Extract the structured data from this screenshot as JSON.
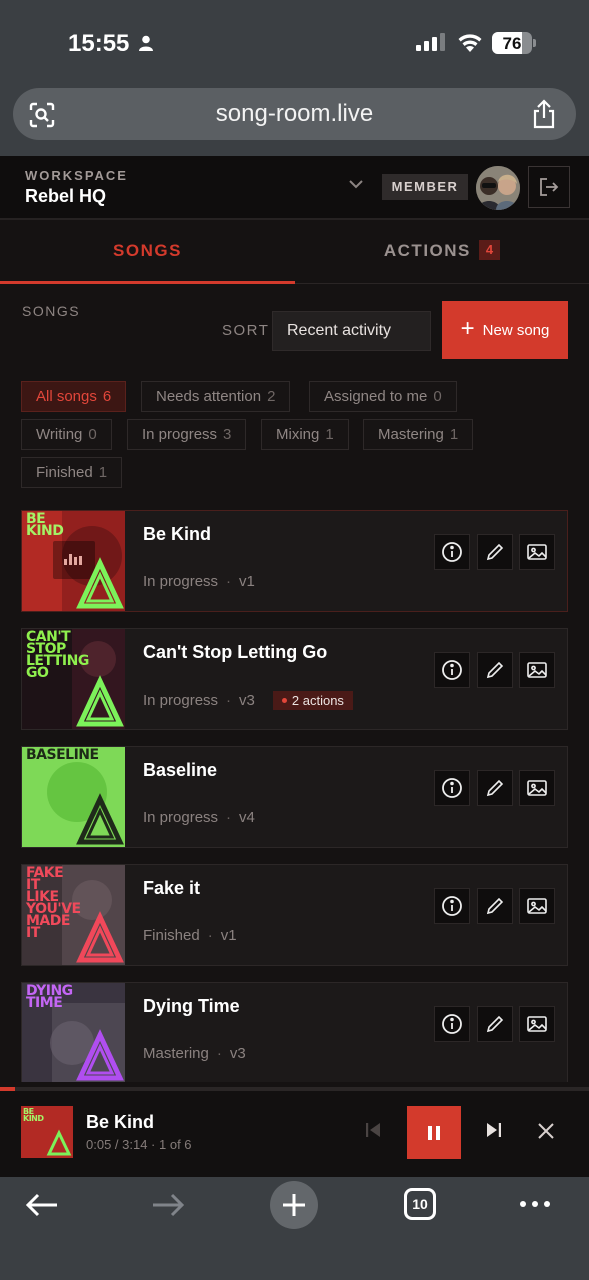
{
  "status_bar": {
    "time": "15:55",
    "battery": "76",
    "battery_fraction": 0.76
  },
  "browser": {
    "url": "song-room.live",
    "tab_count": "10"
  },
  "header": {
    "workspace_label": "WORKSPACE",
    "workspace_name": "Rebel HQ",
    "role": "MEMBER"
  },
  "tabs": [
    {
      "label": "SONGS"
    },
    {
      "label": "ACTIONS",
      "count": "4"
    }
  ],
  "toolbar": {
    "section_label": "SONGS",
    "sort_label": "SORT",
    "sort_value": "Recent activity",
    "new_song_label": "New song"
  },
  "filters": [
    {
      "label": "All songs",
      "count": "6"
    },
    {
      "label": "Needs attention",
      "count": "2"
    },
    {
      "label": "Assigned to me",
      "count": "0"
    },
    {
      "label": "Writing",
      "count": "0"
    },
    {
      "label": "In progress",
      "count": "3"
    },
    {
      "label": "Mixing",
      "count": "1"
    },
    {
      "label": "Mastering",
      "count": "1"
    },
    {
      "label": "Finished",
      "count": "1"
    }
  ],
  "songs": [
    {
      "title": "Be Kind",
      "status": "In progress",
      "version": "v1",
      "art_text": "BE\nKIND",
      "actions": ""
    },
    {
      "title": "Can't Stop Letting Go",
      "status": "In progress",
      "version": "v3",
      "art_text": "CAN'T\nSTOP\nLETTING\nGO",
      "actions": "2 actions"
    },
    {
      "title": "Baseline",
      "status": "In progress",
      "version": "v4",
      "art_text": "BASELINE",
      "actions": ""
    },
    {
      "title": "Fake it",
      "status": "Finished",
      "version": "v1",
      "art_text": "FAKE\nIT\nLIKE\nYOU'VE\nMADE\nIT",
      "actions": ""
    },
    {
      "title": "Dying Time",
      "status": "Mastering",
      "version": "v3",
      "art_text": "DYING\nTIME",
      "actions": ""
    }
  ],
  "player": {
    "title": "Be Kind",
    "time": "0:05 / 3:14 · 1 of 6",
    "progress_fraction": 0.026,
    "art_text": "BE\nKIND"
  },
  "colors": {
    "accent": "#d33a2c",
    "background": "#151212"
  }
}
